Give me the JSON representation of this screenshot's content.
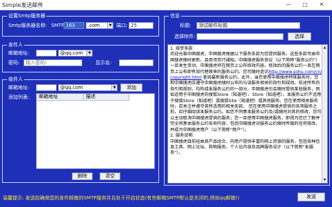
{
  "window": {
    "title": "Simple发送邮件",
    "min": "—",
    "max": "□",
    "close": "✕"
  },
  "smtp": {
    "legend": "设置Smtp服务器",
    "server_label": "Smtp服务器名称:",
    "server_prefix": "SMTP",
    "server_value": "163",
    "server_suffix": ".com",
    "port_label": "端口:",
    "port_value": "25"
  },
  "sender": {
    "legend": "发件人",
    "email_label": "邮箱地址:",
    "email_suffix": "@qq.com",
    "password_label": "密码:",
    "password_placeholder": "输入密码!",
    "display_label": "显示名:"
  },
  "recipients": {
    "legend": "收件人",
    "email_label": "邮箱地址:",
    "email_suffix": "@qq.com",
    "add_button": "添加",
    "list_label": "添加列表:",
    "col_address": "邮箱地址",
    "col_desc": "描述",
    "delete_button": "删除",
    "clear_button": "清空"
  },
  "message": {
    "legend": "信息",
    "subject_label": "标题:",
    "subject_value": "测试邮件标题",
    "attachment_label": "选择附件:",
    "choose_button": "选择",
    "body_paragraphs": [
      "1. 接受条款",
      "   欢迎光临中国搜虎。中国搜虎根据以下服务条款为您提供服务。这些条款可由中国搜虎随时更新，且毋须另行通知。中国搜虎服务协议（以下简称\"服务公约\"）一旦发生变动，中国搜虎将在网页上公布修改内容。修改后的服务公约一旦在网页上公布即有效代替原来的服务公约。您可随时造访",
      "http://www.sohu.com/cn/copyright.html",
      " 查阅最新服务公约。此外，当您使用中国搜虎特殊服务时，您和中国搜虎应遵守中国搜虎随时公布的与该服务相关的指引和规则。前述所有的指引和规则，均构成本服务公约的一部分。中国搜虎也会随时提供某些服务，例如适用于中国搜虎的搜狐Store（知道吧）、Store（知道吧）。本服务公约不适用于搜狐Store（知道吧）或搜狐Site（知道吧）或其他服务。您在使用相关服务时，应关注并遵守其所适用的相关条款。    您在使用中国搜虎提供的各项服务之前，应仔细阅读本服务公约。如您不同意本服务公约及/或随时对其的修改，您可以主动取消中国搜虎提供的服务；您一旦使用中国搜虎服务，即视为您已了解并完全同意本服务公约各项内容，包括中国搜虎对服务公约随时所做的任何修改，并成为中国搜虎用户（以下简称\"用户\"）。",
      "2. 服务说明",
      "  中国搜虎目前经由其产品组合，向用户提供丰富的网上资源的服务，包括各种信息工具、网上论坛、购物服务、个人化内容及品牌服务设计（以下简称\"本服务\"）。"
    ],
    "send_button": "发送"
  },
  "status": {
    "text": "温馨提示: 发送前确保您的发件邮箱的SMTP服务并且处于开启状态(有些邮箱SMTP默认是关闭的,例如qq邮箱!)"
  },
  "colors": {
    "background": "#1e2fb8",
    "status_text": "#ffe733"
  }
}
